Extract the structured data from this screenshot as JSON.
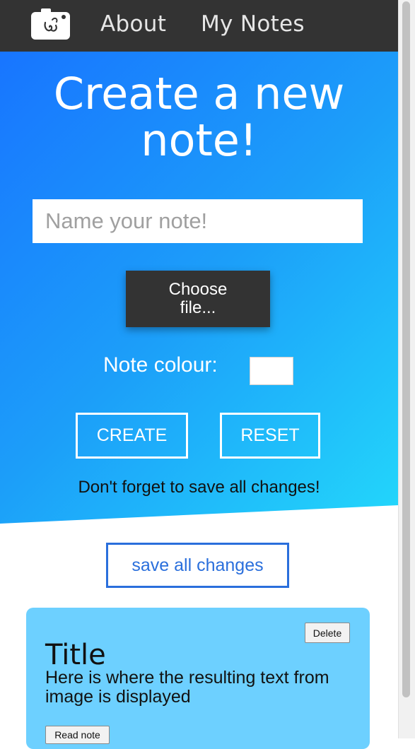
{
  "nav": {
    "logo_icon": "camera-logo-icon",
    "links": [
      {
        "label": "About"
      },
      {
        "label": "My Notes"
      }
    ]
  },
  "hero": {
    "title_line1": "Create a new",
    "title_line2": "note!",
    "name_placeholder": "Name your note!",
    "name_value": "",
    "file_button": "Choose file...",
    "colour_label": "Note colour:",
    "colour_value": "#ffffff",
    "create_button": "CREATE",
    "reset_button": "RESET",
    "reminder": "Don't forget to save all changes!"
  },
  "save_button": "save all changes",
  "notes": [
    {
      "title": "Title",
      "text": "Here is where the resulting text from image is displayed",
      "delete_label": "Delete",
      "read_label": "Read note",
      "color": "#6dd0ff"
    }
  ],
  "colors": {
    "navbar": "#333333",
    "gradient_start": "#1875ff",
    "gradient_end": "#23d7fb",
    "save_accent": "#2a6fdc"
  }
}
